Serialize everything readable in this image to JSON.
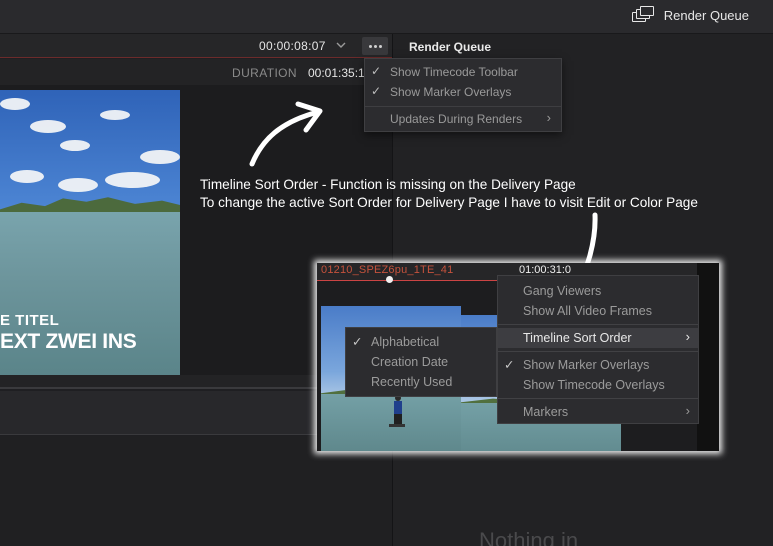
{
  "topbar": {
    "render_queue_label": "Render Queue",
    "icon": "render-queue-icon"
  },
  "viewer": {
    "timecode": "00:00:08:07",
    "duration_label": "DURATION",
    "duration_value": "00:01:35:1",
    "video_title_line1": "E TITEL",
    "video_title_line2": "EXT ZWEI INS"
  },
  "right_panel": {
    "title": "Render Queue",
    "background_text": "Nothing in"
  },
  "viewer_menu": {
    "items": [
      {
        "label": "Show Timecode Toolbar",
        "checked": true
      },
      {
        "label": "Show Marker Overlays",
        "checked": true
      },
      {
        "label": "Updates During Renders",
        "submenu": true
      }
    ]
  },
  "annotation": {
    "line1": "Timeline Sort Order - Function is missing on the Delivery Page",
    "line2": "To change the active Sort Order for Delivery Page I have to visit Edit or Color Page"
  },
  "inset": {
    "clip_name": "01210_SPEZ6pu_1TE_41",
    "timecode": "01:00:31:0",
    "sort_submenu": [
      {
        "label": "Alphabetical",
        "checked": true
      },
      {
        "label": "Creation Date",
        "checked": false
      },
      {
        "label": "Recently Used",
        "checked": false
      }
    ],
    "options_menu": [
      {
        "label": "Gang Viewers"
      },
      {
        "label": "Show All Video Frames"
      },
      {
        "label": "Timeline Sort Order",
        "submenu": true,
        "highlighted": true
      },
      {
        "label": "Show Marker Overlays",
        "checked": true
      },
      {
        "label": "Show Timecode Overlays"
      },
      {
        "label": "Markers",
        "submenu": true
      }
    ]
  }
}
